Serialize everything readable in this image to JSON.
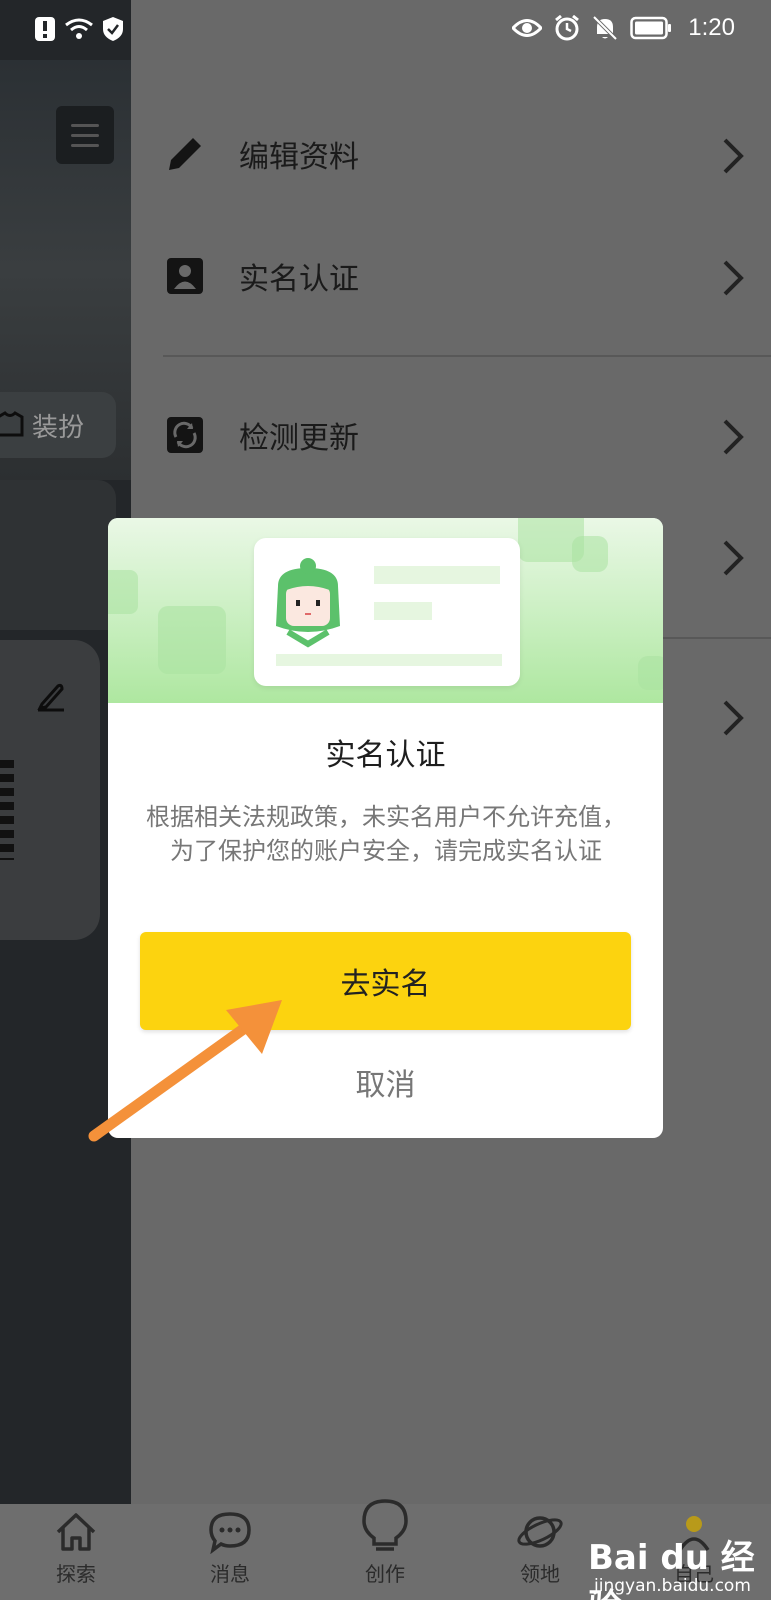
{
  "status_bar": {
    "time": "1:20"
  },
  "side_panel": {
    "dress_label": "装扮"
  },
  "settings": {
    "items": [
      {
        "label": "编辑资料",
        "icon": "pencil-icon"
      },
      {
        "label": "实名认证",
        "icon": "id-card-icon"
      },
      {
        "label": "检测更新",
        "icon": "refresh-icon"
      }
    ]
  },
  "dialog": {
    "title": "实名认证",
    "body": "根据相关法规政策，未实名用户不允许充值，为了保护您的账户安全，请完成实名认证",
    "confirm_label": "去实名",
    "cancel_label": "取消"
  },
  "bottom_nav": {
    "items": [
      {
        "label": "探索",
        "icon": "home-icon"
      },
      {
        "label": "消息",
        "icon": "chat-icon"
      },
      {
        "label": "创作",
        "icon": "lightbulb-icon"
      },
      {
        "label": "领地",
        "icon": "planet-icon"
      },
      {
        "label": "自己",
        "icon": "profile-icon"
      }
    ]
  },
  "watermark": {
    "logo": "Bai du 经验",
    "site": "jingyan.baidu.com"
  },
  "colors": {
    "accent": "#fcd30f",
    "annotation_arrow": "#f4913a",
    "banner_green": "#c9efc0"
  }
}
